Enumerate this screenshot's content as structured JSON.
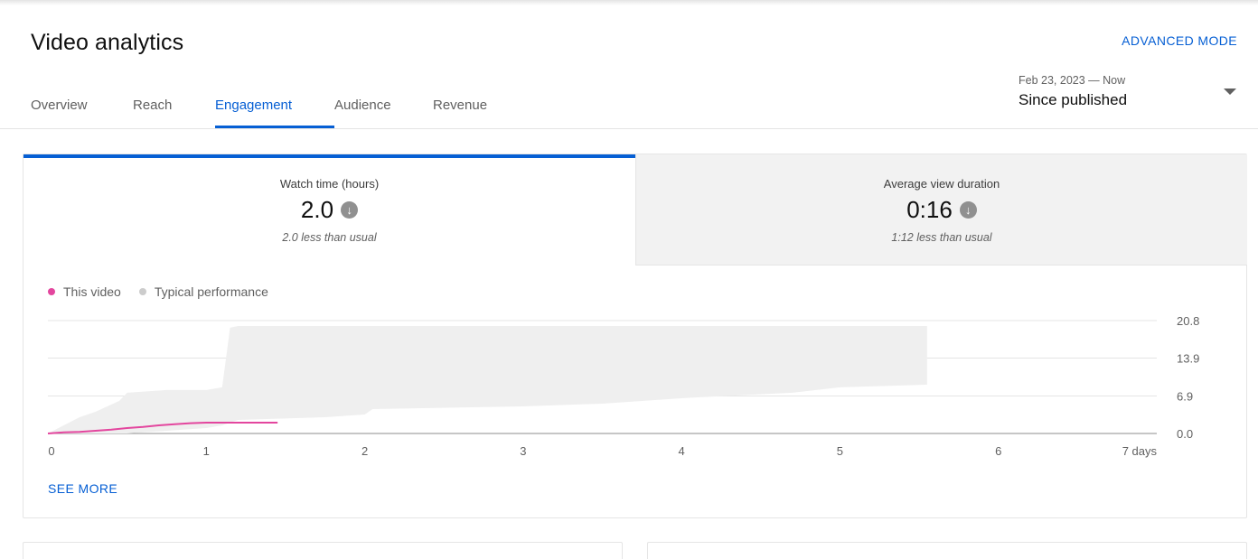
{
  "page": {
    "title": "Video analytics",
    "advanced_mode_label": "ADVANCED MODE"
  },
  "tabs": [
    {
      "label": "Overview",
      "active": false
    },
    {
      "label": "Reach",
      "active": false
    },
    {
      "label": "Engagement",
      "active": true
    },
    {
      "label": "Audience",
      "active": false
    },
    {
      "label": "Revenue",
      "active": false
    }
  ],
  "date_range": {
    "range_text": "Feb 23, 2023 — Now",
    "selected": "Since published",
    "icon": "caret-down-icon"
  },
  "metrics": [
    {
      "label": "Watch time (hours)",
      "value": "2.0",
      "note": "2.0 less than usual",
      "selected": true,
      "icon": "arrow-down-circle-icon"
    },
    {
      "label": "Average view duration",
      "value": "0:16",
      "note": "1:12 less than usual",
      "selected": false,
      "icon": "arrow-down-circle-icon"
    }
  ],
  "legend": {
    "this_video": "This video",
    "typical": "Typical performance"
  },
  "colors": {
    "accent": "#065fd4",
    "this_video": "#e3469e",
    "typical_band": "#efefef",
    "typical_dot": "#cccccc"
  },
  "see_more_label": "SEE MORE",
  "chart_data": {
    "type": "area",
    "x_tick_labels": [
      "0",
      "1",
      "2",
      "3",
      "4",
      "5",
      "6",
      "7 days"
    ],
    "x_ticks": [
      0,
      1,
      2,
      3,
      4,
      5,
      6,
      7
    ],
    "y_tick_labels": [
      "0.0",
      "6.9",
      "13.9",
      "20.8"
    ],
    "y_ticks": [
      0,
      6.9,
      13.9,
      20.8
    ],
    "xlim": [
      0,
      7
    ],
    "ylim": [
      0,
      20.8
    ],
    "grid": true,
    "legend_position": "top-left",
    "series": [
      {
        "name": "This video",
        "type": "line",
        "x": [
          0,
          0.1,
          0.2,
          0.3,
          0.4,
          0.5,
          0.6,
          0.7,
          0.8,
          0.9,
          1.0,
          1.1,
          1.2,
          1.3,
          1.45
        ],
        "y": [
          0,
          0.2,
          0.3,
          0.5,
          0.7,
          1.0,
          1.2,
          1.5,
          1.7,
          1.9,
          2.0,
          2.0,
          2.0,
          2.0,
          2.0
        ]
      },
      {
        "name": "Typical performance",
        "type": "band",
        "x": [
          0,
          0.1,
          0.2,
          0.3,
          0.45,
          0.5,
          0.75,
          1.0,
          1.1,
          1.15,
          1.2,
          1.75,
          2.0,
          2.05,
          3.0,
          3.5,
          3.75,
          4.0,
          4.7,
          5.0,
          5.55
        ],
        "upper": [
          0,
          1.5,
          3.0,
          4.0,
          6.0,
          7.5,
          8.0,
          8.0,
          8.5,
          19.5,
          19.8,
          19.8,
          19.8,
          19.8,
          19.8,
          19.8,
          19.8,
          19.8,
          19.8,
          19.8,
          19.8
        ],
        "lower": [
          0,
          0,
          0,
          0,
          0,
          0,
          0.5,
          1.0,
          1.5,
          2.0,
          2.5,
          3.0,
          3.5,
          4.5,
          5.0,
          5.5,
          6.0,
          6.5,
          7.5,
          8.5,
          9.0
        ]
      }
    ]
  }
}
